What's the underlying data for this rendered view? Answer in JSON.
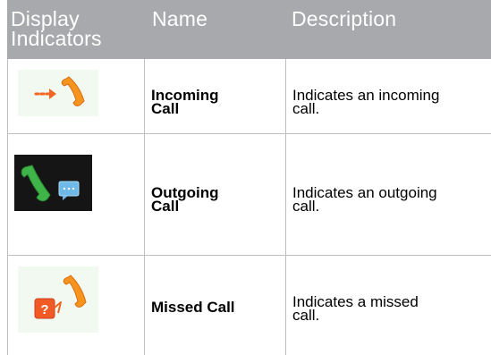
{
  "table": {
    "headers": {
      "col1_line1": "Display",
      "col1_line2": "Indicators",
      "col2": "Name",
      "col3": "Description"
    },
    "rows": [
      {
        "icon": "incoming-call-icon",
        "name_line1": "Incoming",
        "name_line2": "Call",
        "desc_line1": "Indicates an incoming",
        "desc_line2": "call."
      },
      {
        "icon": "outgoing-call-icon",
        "name_line1": "Outgoing",
        "name_line2": "Call",
        "desc_line1": "Indicates an outgoing",
        "desc_line2": "call."
      },
      {
        "icon": "missed-call-icon",
        "name_line1": "Missed Call",
        "desc_line1": "Indicates a missed",
        "desc_line2": "call."
      }
    ]
  },
  "colors": {
    "header_bg": "#a7a9ac",
    "grid_line": "#bdbfc1",
    "handset_orange": "#f7941d",
    "handset_green": "#3fb549",
    "arrow_orange": "#f26522",
    "missed_badge": "#f15a24"
  }
}
